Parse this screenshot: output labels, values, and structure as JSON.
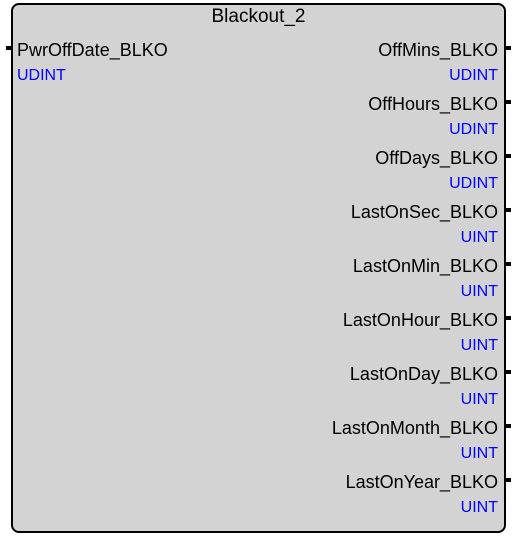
{
  "block": {
    "title": "Blackout_2",
    "colors": {
      "fill": "#d3d3d3",
      "border": "#000000",
      "type_text": "#0000ff"
    },
    "inputs": [
      {
        "name": "PwrOffDate_BLKO",
        "type": "UDINT"
      }
    ],
    "outputs": [
      {
        "name": "OffMins_BLKO",
        "type": "UDINT"
      },
      {
        "name": "OffHours_BLKO",
        "type": "UDINT"
      },
      {
        "name": "OffDays_BLKO",
        "type": "UDINT"
      },
      {
        "name": "LastOnSec_BLKO",
        "type": "UINT"
      },
      {
        "name": "LastOnMin_BLKO",
        "type": "UINT"
      },
      {
        "name": "LastOnHour_BLKO",
        "type": "UINT"
      },
      {
        "name": "LastOnDay_BLKO",
        "type": "UINT"
      },
      {
        "name": "LastOnMonth_BLKO",
        "type": "UINT"
      },
      {
        "name": "LastOnYear_BLKO",
        "type": "UINT"
      }
    ]
  }
}
